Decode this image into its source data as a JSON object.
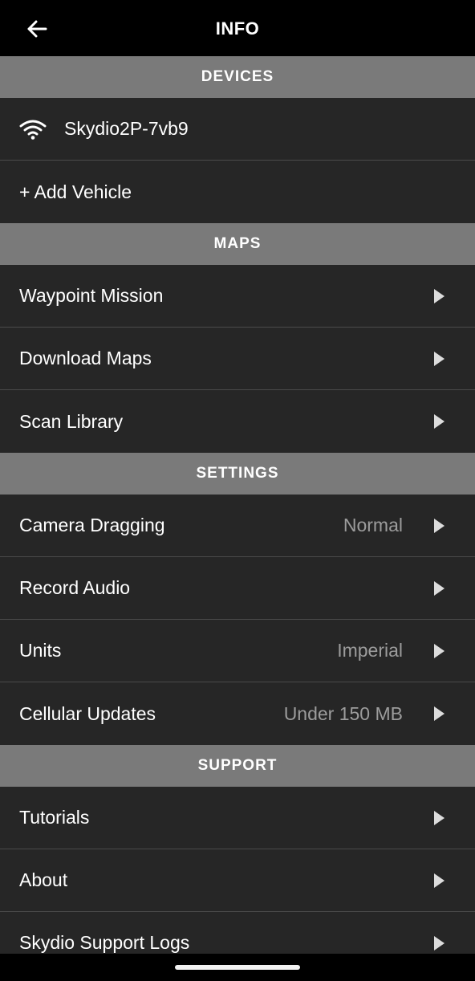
{
  "header": {
    "title": "INFO",
    "back_icon": "arrow-left-icon"
  },
  "sections": {
    "devices": {
      "title": "DEVICES",
      "device_name": "Skydio2P-7vb9",
      "device_icon": "wifi-icon",
      "add_vehicle": "+ Add Vehicle"
    },
    "maps": {
      "title": "MAPS",
      "waypoint_mission": "Waypoint Mission",
      "download_maps": "Download Maps",
      "scan_library": "Scan Library"
    },
    "settings": {
      "title": "SETTINGS",
      "camera_dragging": {
        "label": "Camera Dragging",
        "value": "Normal"
      },
      "record_audio": {
        "label": "Record Audio"
      },
      "units": {
        "label": "Units",
        "value": "Imperial"
      },
      "cellular_updates": {
        "label": "Cellular Updates",
        "value": "Under 150 MB"
      }
    },
    "support": {
      "title": "SUPPORT",
      "tutorials": "Tutorials",
      "about": "About",
      "support_logs": "Skydio Support Logs"
    }
  },
  "colors": {
    "background": "#262626",
    "section_header": "#7a7a7a",
    "divider": "#4a4a4a",
    "value_text": "#9c9c9c"
  }
}
